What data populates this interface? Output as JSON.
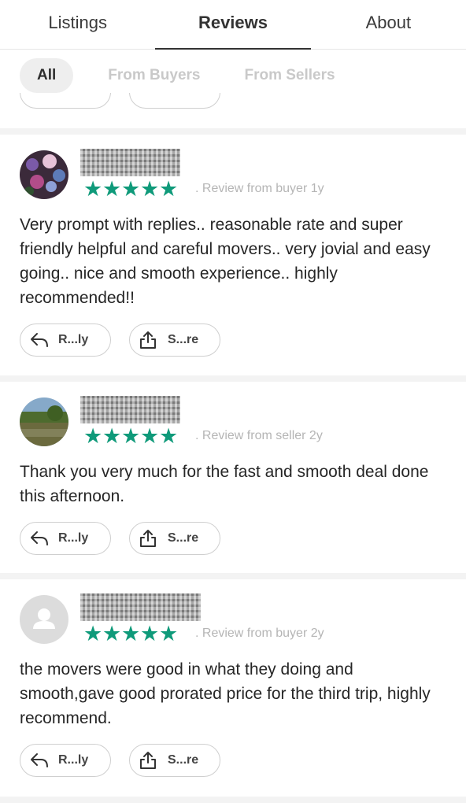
{
  "tabs": [
    "Listings",
    "Reviews",
    "About"
  ],
  "filters": [
    "All",
    "From Buyers",
    "From Sellers"
  ],
  "actions": {
    "reply": "R...ly",
    "share": "S...re"
  },
  "colors": {
    "star": "#0f9a7a",
    "accent_text": "#333333"
  },
  "reviews": [
    {
      "meta": ". Review from buyer 1y",
      "rating": 5,
      "text": "Very prompt with replies.. reasonable rate and super friendly helpful and careful movers.. very jovial and easy going.. nice and smooth experience.. highly recommended!!"
    },
    {
      "meta": ". Review from seller 2y",
      "rating": 5,
      "text": "Thank you very much for the fast and smooth deal done this afternoon."
    },
    {
      "meta": ". Review from buyer 2y",
      "rating": 5,
      "text": "the movers were good in what they doing and smooth,gave  good prorated price for the third trip, highly recommend."
    }
  ]
}
